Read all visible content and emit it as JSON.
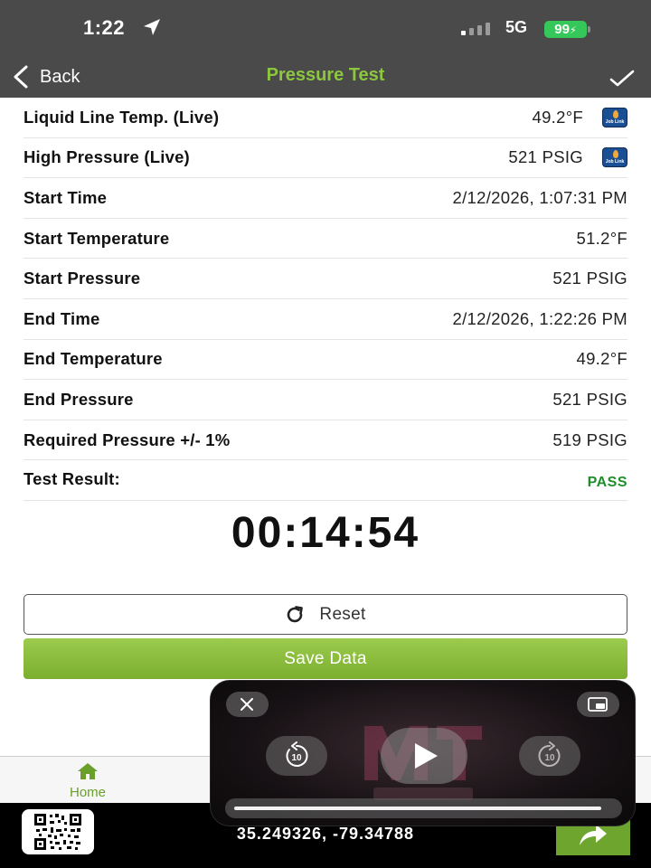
{
  "status_bar": {
    "time": "1:22",
    "network": "5G",
    "battery": "99"
  },
  "nav": {
    "back_label": "Back",
    "title": "Pressure Test"
  },
  "rows": [
    {
      "label": "Liquid Line Temp. (Live)",
      "value": "49.2°F",
      "icon": "job-link-icon"
    },
    {
      "label": "High Pressure (Live)",
      "value": "521 PSIG",
      "icon": "job-link-icon"
    },
    {
      "label": "Start Time",
      "value": "2/12/2026, 1:07:31 PM"
    },
    {
      "label": "Start Temperature",
      "value": "51.2°F"
    },
    {
      "label": "Start Pressure",
      "value": "521 PSIG"
    },
    {
      "label": "End Time",
      "value": "2/12/2026, 1:22:26 PM"
    },
    {
      "label": "End Temperature",
      "value": "49.2°F"
    },
    {
      "label": "End Pressure",
      "value": "521 PSIG"
    },
    {
      "label": "Required Pressure +/- 1%",
      "value": "519 PSIG"
    },
    {
      "label": "Test Result:",
      "value": "PASS"
    }
  ],
  "timer": "00:14:54",
  "buttons": {
    "reset": "Reset",
    "save": "Save Data"
  },
  "tab_bar": {
    "home": "Home"
  },
  "bottom": {
    "coordinates": "35.249326, -79.34788"
  },
  "pip": {
    "progress": 0.97
  },
  "colors": {
    "accent_green": "#8dc63f",
    "pass_green": "#1e8f2a",
    "header_bg": "#4a4a4a"
  }
}
